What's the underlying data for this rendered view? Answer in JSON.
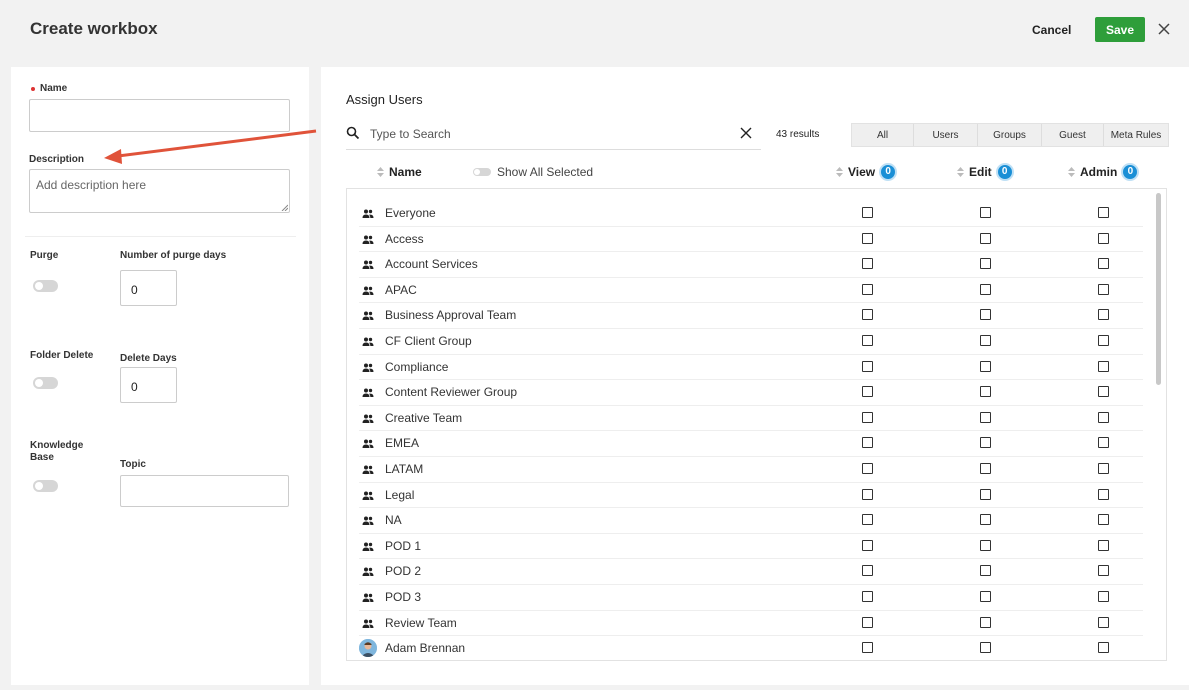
{
  "header": {
    "title": "Create workbox",
    "cancel_label": "Cancel",
    "save_label": "Save",
    "save_color": "#2e9e3a"
  },
  "form": {
    "name_label": "Name",
    "name_value": "",
    "description_label": "Description",
    "description_placeholder": "Add description here",
    "purge_label": "Purge",
    "purge_days_label": "Number of purge days",
    "purge_days_value": "0",
    "folder_delete_label": "Folder Delete",
    "delete_days_label": "Delete Days",
    "delete_days_value": "0",
    "knowledge_label_1": "Knowledge",
    "knowledge_label_2": "Base",
    "topic_label": "Topic",
    "topic_value": ""
  },
  "assign": {
    "title": "Assign Users",
    "search_placeholder": "Type to Search",
    "results": "43 results",
    "filters": [
      "All",
      "Users",
      "Groups",
      "Guest",
      "Meta Rules"
    ],
    "columns": {
      "name": "Name",
      "show_all_selected": "Show All Selected",
      "view": "View",
      "view_count": "0",
      "edit": "Edit",
      "edit_count": "0",
      "admin": "Admin",
      "admin_count": "0"
    },
    "rows": [
      {
        "name": "Everyone",
        "icon": "group-icon"
      },
      {
        "name": "Access",
        "icon": "group-icon"
      },
      {
        "name": "Account Services",
        "icon": "group-icon"
      },
      {
        "name": "APAC",
        "icon": "group-icon"
      },
      {
        "name": "Business Approval Team",
        "icon": "group-icon"
      },
      {
        "name": "CF Client Group",
        "icon": "group-icon"
      },
      {
        "name": "Compliance",
        "icon": "group-icon"
      },
      {
        "name": "Content Reviewer Group",
        "icon": "group-icon"
      },
      {
        "name": "Creative Team",
        "icon": "group-icon"
      },
      {
        "name": "EMEA",
        "icon": "group-icon"
      },
      {
        "name": "LATAM",
        "icon": "group-icon"
      },
      {
        "name": "Legal",
        "icon": "group-icon"
      },
      {
        "name": "NA",
        "icon": "group-icon"
      },
      {
        "name": "POD 1",
        "icon": "group-icon"
      },
      {
        "name": "POD 2",
        "icon": "group-icon"
      },
      {
        "name": "POD 3",
        "icon": "group-icon"
      },
      {
        "name": "Review Team",
        "icon": "group-icon"
      },
      {
        "name": "Adam Brennan",
        "icon": "user-avatar"
      }
    ],
    "badge_color": "#1a8fd6"
  },
  "annotation": {
    "arrow_color": "#e0533a"
  }
}
